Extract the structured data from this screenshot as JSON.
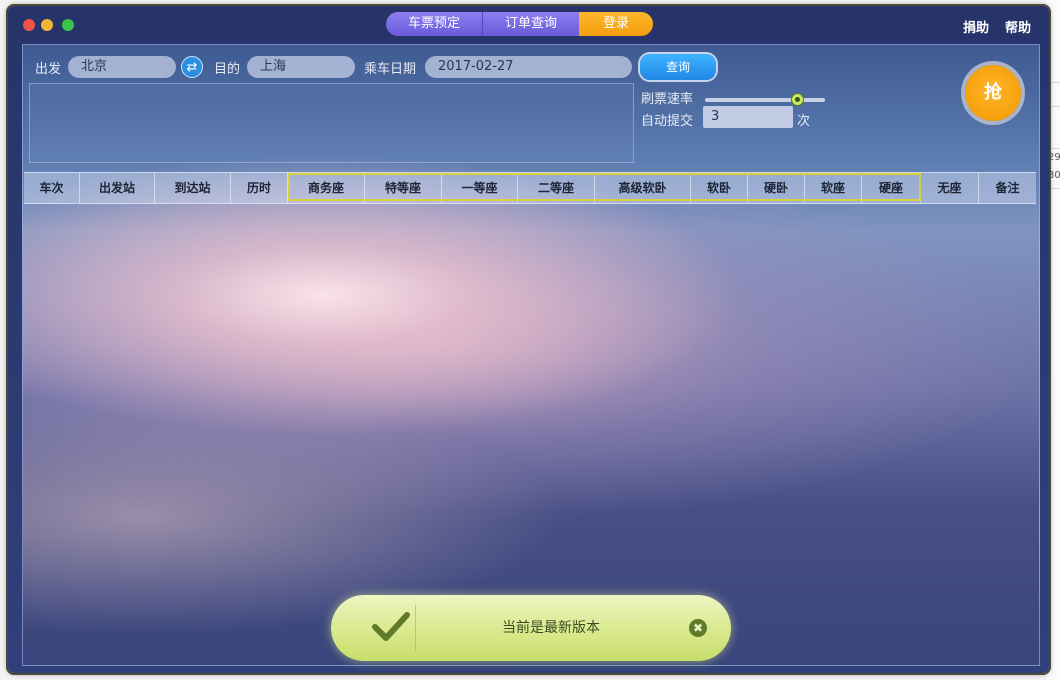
{
  "window": {
    "tabs": [
      {
        "label": "车票预定"
      },
      {
        "label": "订单查询"
      },
      {
        "label": "登录"
      }
    ],
    "links": {
      "donate": "捐助",
      "help": "帮助"
    }
  },
  "search": {
    "from_label": "出发",
    "from_value": "北京",
    "to_label": "目的",
    "to_value": "上海",
    "date_label": "乘车日期",
    "date_value": "2017-02-27",
    "query_label": "查询",
    "swap_icon": "swap-icon"
  },
  "settings": {
    "rate_label": "刷票速率",
    "rate_level": 0.77,
    "auto_label": "自动提交",
    "auto_value": "3",
    "auto_unit": "次"
  },
  "grab_label": "抢",
  "table": {
    "columns": [
      "车次",
      "出发站",
      "到达站",
      "历时",
      "商务座",
      "特等座",
      "一等座",
      "二等座",
      "高级软卧",
      "软卧",
      "硬卧",
      "软座",
      "硬座",
      "无座",
      "备注"
    ]
  },
  "toast": {
    "message": "当前是最新版本",
    "close_symbol": "✖"
  },
  "background_window": {
    "fragments": [
      "29",
      "30"
    ]
  },
  "colors": {
    "accent_orange": "#f6a10c",
    "tab_purple": "#7b6be4",
    "query_blue": "#1f88e6",
    "highlight_yellow": "#d9d040",
    "toast_green": "#d9e98d"
  }
}
